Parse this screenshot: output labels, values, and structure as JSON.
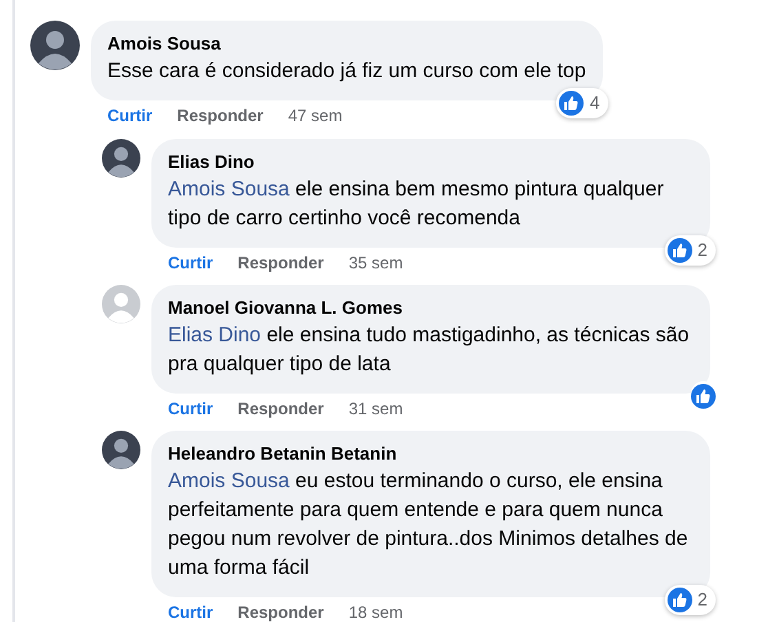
{
  "comments": [
    {
      "default_avatar": false,
      "author": "Amois Sousa",
      "text": "Esse cara é considerado já fiz um curso com ele top",
      "reacted": true,
      "reaction_count": "4",
      "like": "Curtir",
      "reply": "Responder",
      "time": "47 sem",
      "replies": [
        {
          "default_avatar": false,
          "author": "Elias Dino",
          "mention": "Amois Sousa",
          "text": "ele ensina bem mesmo pintura qualquer tipo de carro certinho você recomenda",
          "reacted": true,
          "reaction_count": "2",
          "like": "Curtir",
          "reply": "Responder",
          "time": "35 sem"
        },
        {
          "default_avatar": true,
          "author": "Manoel Giovanna L. Gomes",
          "mention": "Elias Dino",
          "text": "ele ensina tudo mastigadinho, as técnicas são pra qualquer tipo de lata",
          "reacted": true,
          "like": "Curtir",
          "reply": "Responder",
          "time": "31 sem"
        },
        {
          "default_avatar": false,
          "author": "Heleandro Betanin Betanin",
          "mention": "Amois Sousa",
          "text": "eu estou terminando o curso, ele ensina perfeitamente para quem entende e para quem nunca pegou num revolver de pintura..dos Minimos detalhes de uma forma fácil",
          "reacted": true,
          "reaction_count": "2",
          "like": "Curtir",
          "reply": "Responder",
          "time": "18 sem"
        }
      ]
    }
  ]
}
